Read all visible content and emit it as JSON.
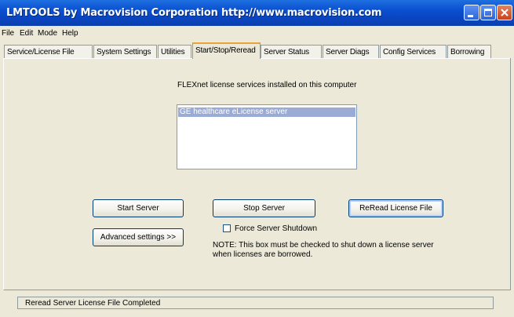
{
  "window": {
    "title": "LMTOOLS by Macrovision Corporation http://www.macrovision.com"
  },
  "menu": [
    "File",
    "Edit",
    "Mode",
    "Help"
  ],
  "tabs": [
    "Service/License File",
    "System Settings",
    "Utilities",
    "Start/Stop/Reread",
    "Server Status",
    "Server Diags",
    "Config Services",
    "Borrowing"
  ],
  "active_tab": "Start/Stop/Reread",
  "main": {
    "list_heading": "FLEXnet license services installed on this computer",
    "services": [
      "GE healthcare eLicense server"
    ],
    "start_button": "Start Server",
    "stop_button": "Stop Server",
    "reread_button": "ReRead License File",
    "advanced_button": "Advanced settings >>",
    "force_shutdown_label": "Force Server Shutdown",
    "note_line1": "NOTE:  This box must be checked to shut down a license server",
    "note_line2": "when licenses are borrowed."
  },
  "status": {
    "text": "Reread Server License File Completed"
  }
}
